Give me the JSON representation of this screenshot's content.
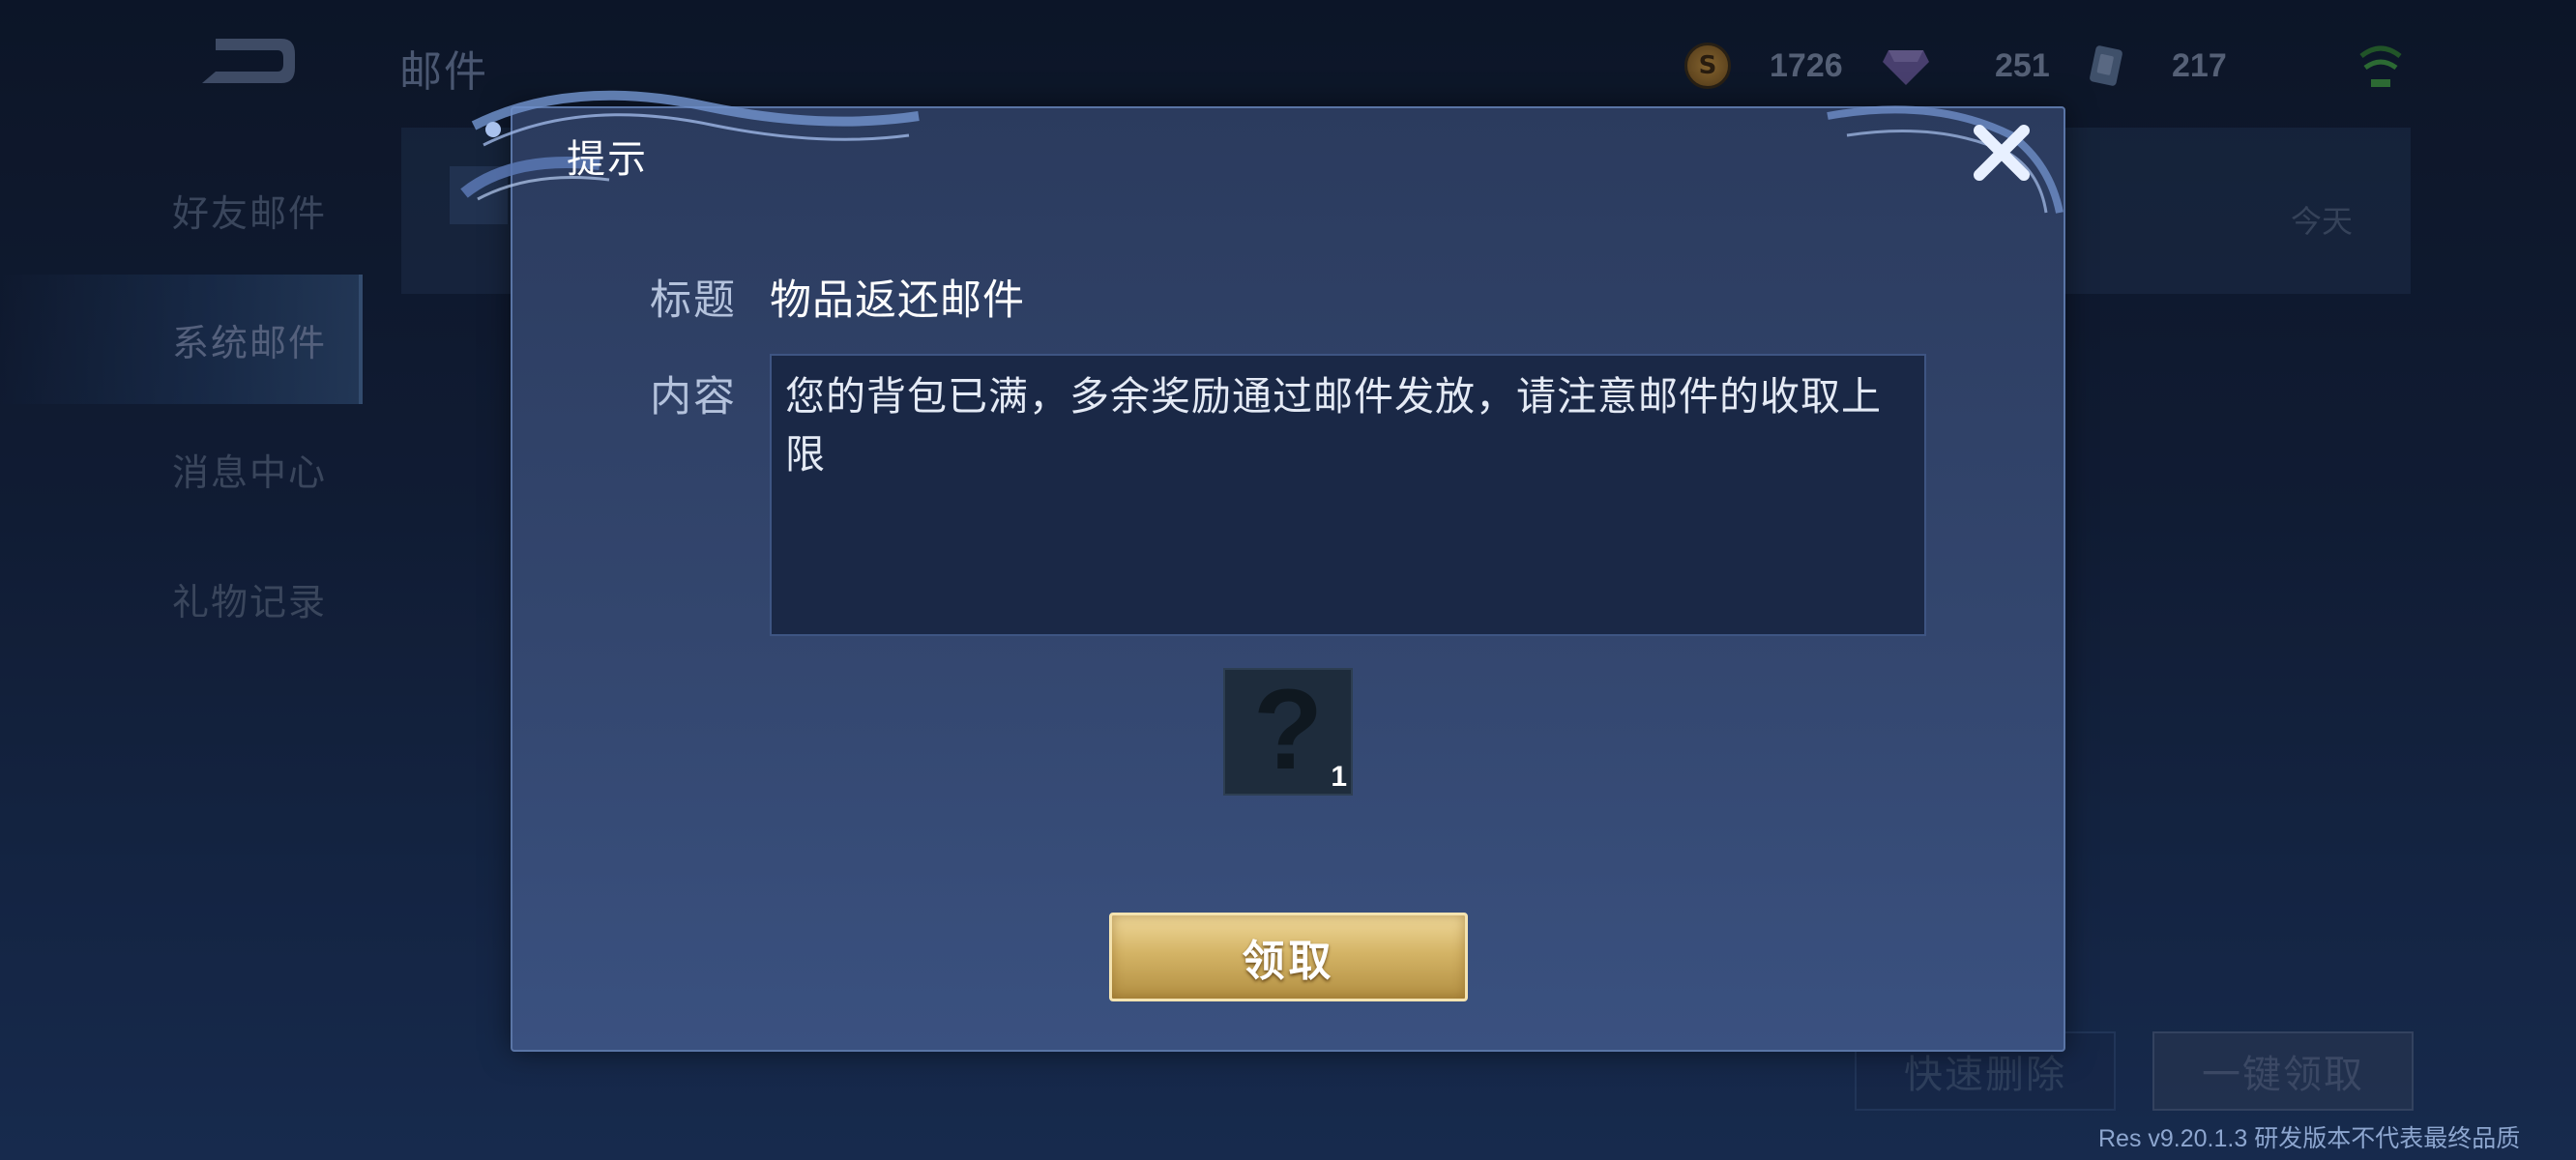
{
  "header": {
    "title": "邮件",
    "currencies": [
      {
        "icon": "gold-coin-icon",
        "value": "1726",
        "color": "#b07a2c"
      },
      {
        "icon": "gem-icon",
        "value": "251",
        "color": "#7b6aa8"
      },
      {
        "icon": "voucher-icon",
        "value": "217",
        "color": "#6f86a8"
      }
    ]
  },
  "sidebar": {
    "items": [
      {
        "label": "好友邮件"
      },
      {
        "label": "系统邮件"
      },
      {
        "label": "消息中心"
      },
      {
        "label": "礼物记录"
      }
    ],
    "active_index": 1
  },
  "mail_list": {
    "rows": [
      {
        "date": "今天"
      }
    ]
  },
  "footer": {
    "quick_delete_label": "快速删除",
    "claim_all_label": "一键领取",
    "version": "Res v9.20.1.3 研发版本不代表最终品质"
  },
  "dialog": {
    "title": "提示",
    "subject_label": "标题",
    "subject_value": "物品返还邮件",
    "content_label": "内容",
    "content_value": "您的背包已满，多余奖励通过邮件发放，请注意邮件的收取上限",
    "reward": {
      "icon": "question-mark-icon",
      "count": "1"
    },
    "claim_label": "领取"
  },
  "colors": {
    "accent_gold": "#d4b466",
    "dialog_bg": "#33466e",
    "content_bg": "#1a2846"
  }
}
